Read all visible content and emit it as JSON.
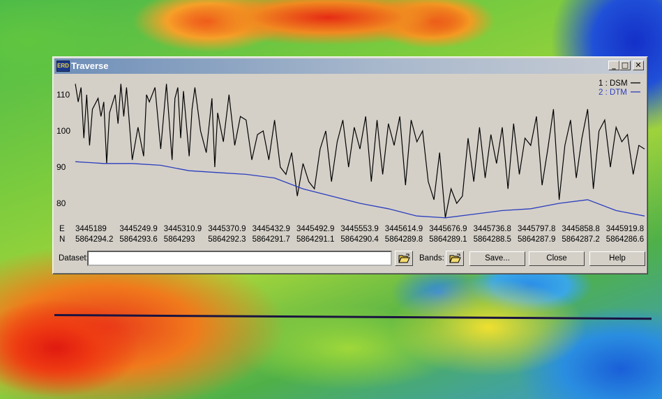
{
  "window": {
    "title": "Traverse",
    "app_icon_text": "ERD",
    "min_glyph": "_",
    "max_glyph": "□",
    "close_glyph": "✕"
  },
  "chart_data": {
    "type": "line",
    "ylim": [
      75,
      115
    ],
    "yticks": [
      80,
      90,
      100,
      110
    ],
    "legend_position": "top-right",
    "series": [
      {
        "name": "1 : DSM",
        "color": "#000000",
        "x": [
          0,
          0.005,
          0.01,
          0.015,
          0.02,
          0.025,
          0.03,
          0.04,
          0.045,
          0.05,
          0.055,
          0.06,
          0.07,
          0.075,
          0.08,
          0.085,
          0.09,
          0.1,
          0.11,
          0.12,
          0.125,
          0.13,
          0.14,
          0.15,
          0.16,
          0.17,
          0.175,
          0.18,
          0.185,
          0.19,
          0.2,
          0.205,
          0.21,
          0.22,
          0.23,
          0.24,
          0.245,
          0.25,
          0.26,
          0.27,
          0.28,
          0.29,
          0.3,
          0.31,
          0.32,
          0.33,
          0.34,
          0.35,
          0.36,
          0.37,
          0.38,
          0.39,
          0.4,
          0.41,
          0.42,
          0.43,
          0.44,
          0.45,
          0.46,
          0.47,
          0.48,
          0.49,
          0.5,
          0.51,
          0.52,
          0.53,
          0.54,
          0.55,
          0.56,
          0.57,
          0.58,
          0.59,
          0.6,
          0.61,
          0.62,
          0.63,
          0.64,
          0.65,
          0.66,
          0.67,
          0.68,
          0.69,
          0.7,
          0.71,
          0.72,
          0.73,
          0.74,
          0.75,
          0.76,
          0.77,
          0.78,
          0.79,
          0.8,
          0.81,
          0.82,
          0.83,
          0.84,
          0.85,
          0.86,
          0.87,
          0.88,
          0.89,
          0.9,
          0.91,
          0.92,
          0.93,
          0.94,
          0.95,
          0.96,
          0.97,
          0.98,
          0.99,
          1.0
        ],
        "y": [
          113,
          108,
          112,
          98,
          110,
          96,
          106,
          109,
          104,
          108,
          91,
          105,
          110,
          102,
          113,
          104,
          112,
          92,
          101,
          93,
          110,
          108,
          112,
          95,
          113,
          92,
          109,
          112,
          98,
          111,
          93,
          106,
          112,
          100,
          94,
          109,
          90,
          105,
          97,
          110,
          96,
          104,
          103,
          92,
          99,
          100,
          92,
          103,
          90,
          88,
          94,
          82,
          91,
          86,
          84,
          95,
          100,
          86,
          97,
          103,
          90,
          101,
          95,
          104,
          86,
          103,
          88,
          102,
          96,
          104,
          85,
          103,
          97,
          100,
          86,
          81,
          94,
          76,
          84,
          80,
          82,
          98,
          86,
          101,
          87,
          99,
          91,
          101,
          84,
          102,
          88,
          98,
          96,
          104,
          85,
          95,
          106,
          81,
          96,
          103,
          87,
          98,
          106,
          84,
          100,
          103,
          90,
          101,
          97,
          99,
          88,
          96,
          95
        ]
      },
      {
        "name": "2 : DTM",
        "color": "#2b3dbd",
        "x": [
          0,
          0.05,
          0.1,
          0.15,
          0.2,
          0.25,
          0.3,
          0.35,
          0.4,
          0.45,
          0.5,
          0.55,
          0.6,
          0.65,
          0.7,
          0.75,
          0.8,
          0.85,
          0.9,
          0.95,
          1.0
        ],
        "y": [
          91.5,
          91,
          91,
          90.5,
          89,
          88.5,
          88,
          87,
          84,
          82,
          80,
          78.5,
          76.5,
          76,
          77,
          78,
          78.5,
          80,
          81,
          78,
          76.5
        ]
      }
    ]
  },
  "coords": {
    "e_label": "E",
    "n_label": "N",
    "e_values": [
      "3445189",
      "3445249.9",
      "3445310.9",
      "3445370.9",
      "3445432.9",
      "3445492.9",
      "3445553.9",
      "3445614.9",
      "3445676.9",
      "3445736.8",
      "3445797.8",
      "3445858.8",
      "3445919.8"
    ],
    "n_values": [
      "5864294.2",
      "5864293.6",
      "5864293",
      "5864292.3",
      "5864291.7",
      "5864291.1",
      "5864290.4",
      "5864289.8",
      "5864289.1",
      "5864288.5",
      "5864287.9",
      "5864287.2",
      "5864286.6"
    ]
  },
  "controls": {
    "dataset_label": "Dataset:",
    "dataset_value": "",
    "bands_label": "Bands:",
    "save_label": "Save...",
    "close_label": "Close",
    "help_label": "Help"
  }
}
